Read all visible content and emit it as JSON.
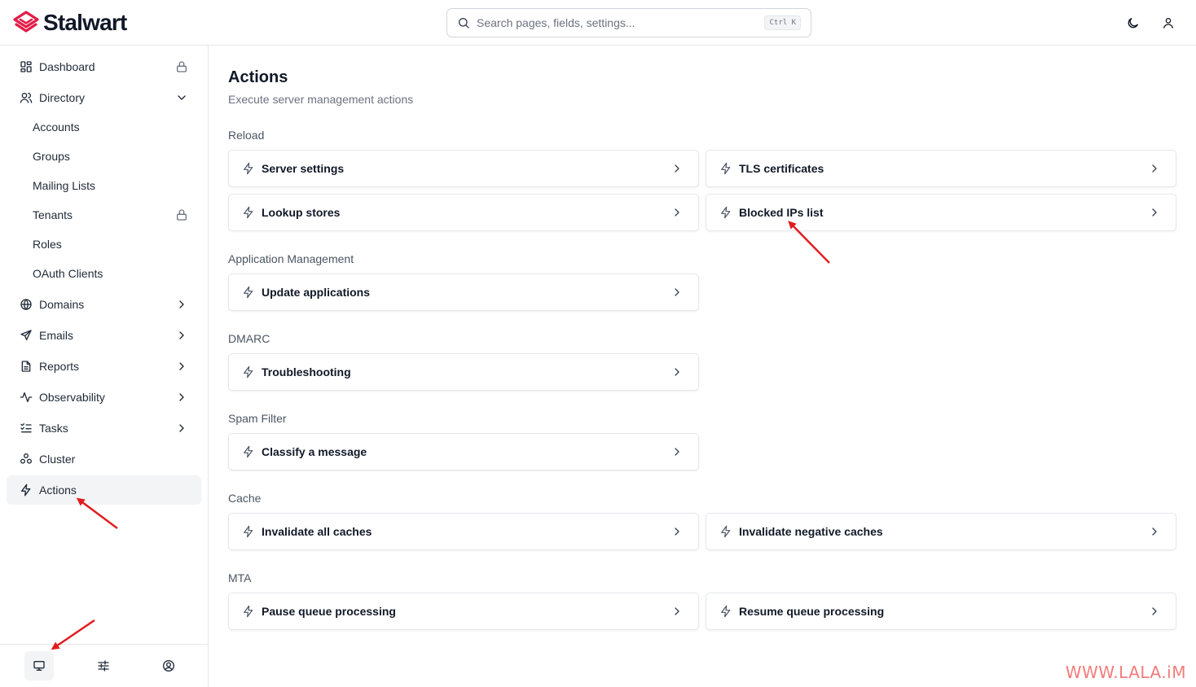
{
  "app": {
    "brand": "Stalwart",
    "brand_color": "#e11d48"
  },
  "search": {
    "placeholder": "Search pages, fields, settings...",
    "shortcut": "Ctrl K"
  },
  "header_icons": [
    "moon-icon",
    "user-icon"
  ],
  "sidebar": {
    "items": [
      {
        "label": "Dashboard",
        "icon": "dashboard-icon",
        "trail": "lock-icon"
      },
      {
        "label": "Directory",
        "icon": "users-icon",
        "trail": "chevron-down-icon"
      },
      {
        "label": "Accounts"
      },
      {
        "label": "Groups"
      },
      {
        "label": "Mailing Lists"
      },
      {
        "label": "Tenants",
        "trail": "lock-icon"
      },
      {
        "label": "Roles"
      },
      {
        "label": "OAuth Clients"
      },
      {
        "label": "Domains",
        "icon": "globe-icon",
        "trail": "chevron-right-icon"
      },
      {
        "label": "Emails",
        "icon": "send-icon",
        "trail": "chevron-right-icon"
      },
      {
        "label": "Reports",
        "icon": "report-icon",
        "trail": "chevron-right-icon"
      },
      {
        "label": "Observability",
        "icon": "activity-icon",
        "trail": "chevron-right-icon"
      },
      {
        "label": "Tasks",
        "icon": "list-checks-icon",
        "trail": "chevron-right-icon"
      },
      {
        "label": "Cluster",
        "icon": "cluster-icon"
      },
      {
        "label": "Actions",
        "icon": "bolt-icon",
        "active": true
      }
    ],
    "footer": [
      "monitor-icon",
      "sliders-icon",
      "user-circle-icon"
    ]
  },
  "main": {
    "title": "Actions",
    "subtitle": "Execute server management actions",
    "sections": [
      {
        "label": "Reload",
        "actions": [
          "Server settings",
          "TLS certificates",
          "Lookup stores",
          "Blocked IPs list"
        ]
      },
      {
        "label": "Application Management",
        "actions": [
          "Update applications"
        ]
      },
      {
        "label": "DMARC",
        "actions": [
          "Troubleshooting"
        ]
      },
      {
        "label": "Spam Filter",
        "actions": [
          "Classify a message"
        ]
      },
      {
        "label": "Cache",
        "actions": [
          "Invalidate all caches",
          "Invalidate negative caches"
        ]
      },
      {
        "label": "MTA",
        "actions": [
          "Pause queue processing",
          "Resume queue processing"
        ]
      }
    ]
  },
  "watermark": "WWW.LALA.iM",
  "annotation_color": "#e11d1d"
}
